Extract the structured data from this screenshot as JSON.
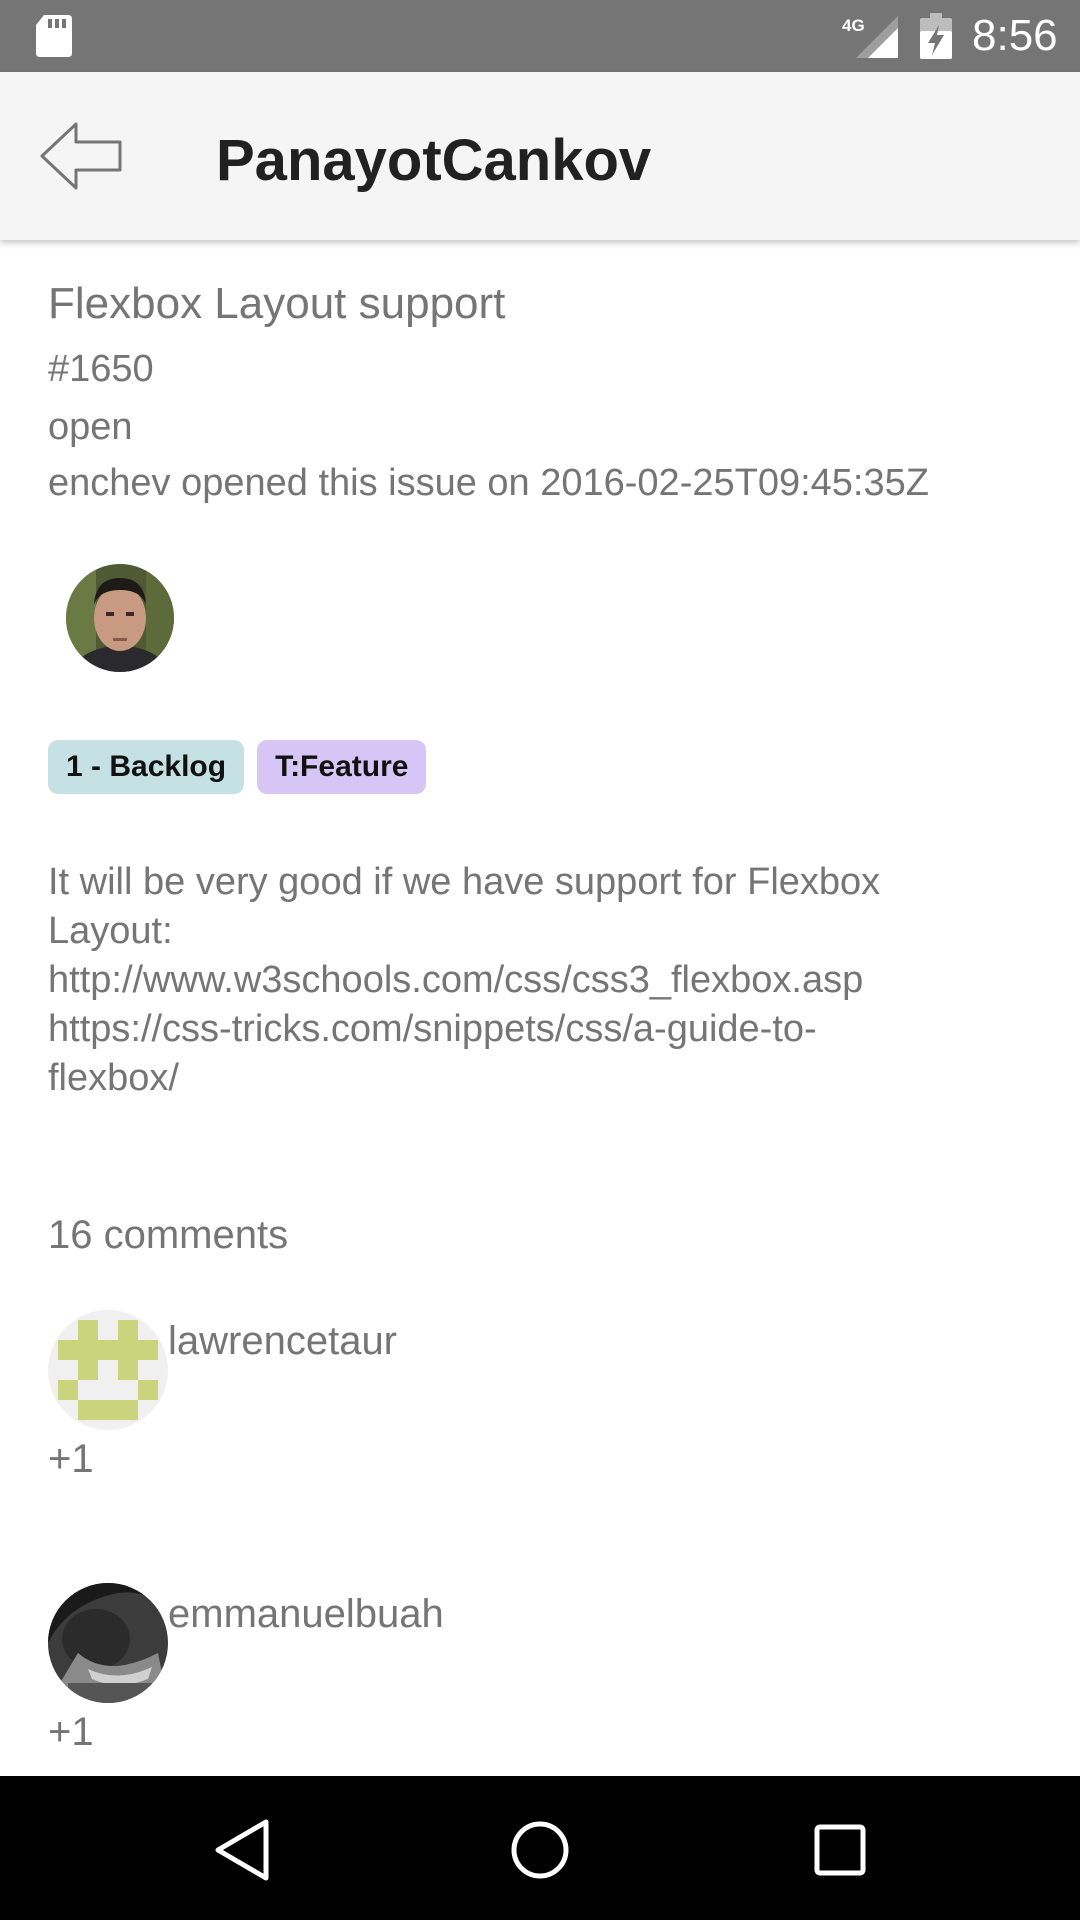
{
  "status_bar": {
    "time": "8:56",
    "network_label": "4G",
    "icons": [
      "sd-card-icon",
      "signal-4g-icon",
      "battery-charging-icon"
    ]
  },
  "app_bar": {
    "title": "PanayotCankov",
    "back_icon": "arrow-left-icon"
  },
  "issue": {
    "title": "Flexbox Layout support",
    "number": "#1650",
    "state": "open",
    "meta": "enchev opened this issue on 2016-02-25T09:45:35Z",
    "labels": [
      {
        "text": "1 - Backlog",
        "color": "#c5e1e3"
      },
      {
        "text": "T:Feature",
        "color": "#d7c5f5"
      }
    ],
    "body_lines": [
      "It will be very good if we have support for Flexbox",
      "Layout:",
      "http://www.w3schools.com/css/css3_flexbox.asp",
      "https://css-tricks.com/snippets/css/a-guide-to-",
      "flexbox/"
    ]
  },
  "comments": {
    "count_label": "16 comments",
    "items": [
      {
        "user": "lawrencetaur",
        "body": "+1"
      },
      {
        "user": "emmanuelbuah",
        "body": "+1"
      }
    ]
  },
  "colors": {
    "status_bar": "#757575",
    "app_bar": "#f5f5f5",
    "nav_bar": "#000000",
    "text_secondary": "#757575",
    "identicon": "#c9d47c"
  },
  "nav_bar": {
    "icons": [
      "nav-back-icon",
      "nav-home-icon",
      "nav-recents-icon"
    ]
  }
}
